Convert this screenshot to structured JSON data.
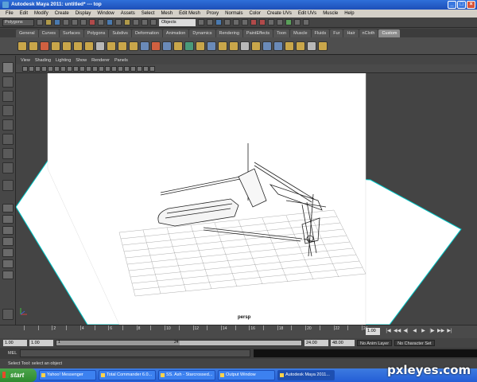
{
  "window": {
    "title": "Autodesk Maya 2011: untitled*   ---   top",
    "minimize": "_",
    "maximize": "□",
    "close": "×"
  },
  "menubar": [
    "File",
    "Edit",
    "Modify",
    "Create",
    "Display",
    "Window",
    "Assets",
    "Select",
    "Mesh",
    "Edit Mesh",
    "Proxy",
    "Normals",
    "Color",
    "Create UVs",
    "Edit UVs",
    "Muscle",
    "Help"
  ],
  "statusline": {
    "mode": "Polygons",
    "object_field": "Objects"
  },
  "shelf_tabs": [
    "General",
    "Curves",
    "Surfaces",
    "Polygons",
    "Subdivs",
    "Deformation",
    "Animation",
    "Dynamics",
    "Rendering",
    "PaintEffects",
    "Toon",
    "Muscle",
    "Fluids",
    "Fur",
    "Hair",
    "nCloth",
    "Custom"
  ],
  "active_shelf_tab": "Custom",
  "panel_menus": [
    "View",
    "Shading",
    "Lighting",
    "Show",
    "Renderer",
    "Panels"
  ],
  "viewport": {
    "camera": "persp"
  },
  "timeline": {
    "tick_labels": [
      "2",
      "4",
      "6",
      "8",
      "10",
      "12",
      "14",
      "16",
      "18",
      "20",
      "22",
      "24"
    ],
    "current_frame": "1.00",
    "playback_glyphs": [
      "|◀",
      "◀◀",
      "◀|",
      "◀",
      "▶",
      "|▶",
      "▶▶",
      "▶|"
    ]
  },
  "range": {
    "start": "1.00",
    "playback_start": "1.00",
    "slider_start": "1",
    "slider_end": "24",
    "playback_end": "24.00",
    "end": "48.00",
    "anim_layer": "No Anim Layer",
    "character_set": "No Character Set"
  },
  "command_line": {
    "label": "MEL"
  },
  "help_line": "Select Tool: select an object",
  "taskbar": {
    "start": "start",
    "items": [
      "Yahoo! Messenger",
      "Total Commander 6.0...",
      "SS. Ash - Starcrossed...",
      "Output Window",
      "Autodesk Maya 2011..."
    ],
    "active_index": 4
  },
  "watermark": "pxleyes.com"
}
